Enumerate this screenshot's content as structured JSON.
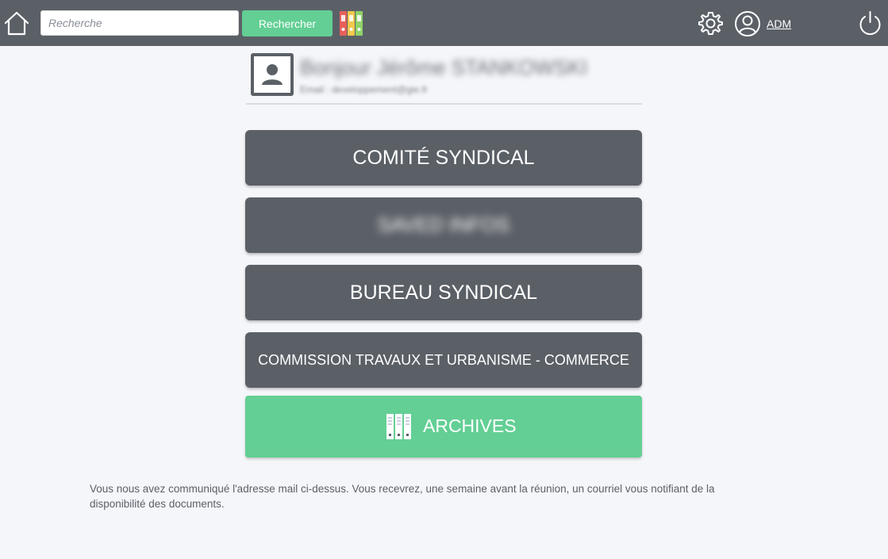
{
  "header": {
    "search_placeholder": "Recherche",
    "search_button_label": "Rechercher",
    "user_label": "ADM",
    "colors": {
      "bar": "#5b6067",
      "accent": "#63cf94",
      "binder_red": "#e8605a",
      "binder_yellow": "#f2c94c",
      "binder_green": "#63cf94"
    }
  },
  "profile": {
    "greeting": "Bonjour Jérôme STANKOWSKI",
    "email_line": "Email : developpement@gie.fr"
  },
  "menu": {
    "items": [
      {
        "label": "COMITÉ SYNDICAL"
      },
      {
        "label": "SAVED INFOS"
      },
      {
        "label": "BUREAU SYNDICAL"
      },
      {
        "label": "COMMISSION TRAVAUX ET URBANISME - COMMERCE"
      }
    ],
    "archives_label": "ARCHIVES"
  },
  "notice": "Vous nous avez communiqué l'adresse mail ci-dessus. Vous recevrez, une semaine avant la réunion, un courriel vous notifiant de la disponibilité des documents."
}
